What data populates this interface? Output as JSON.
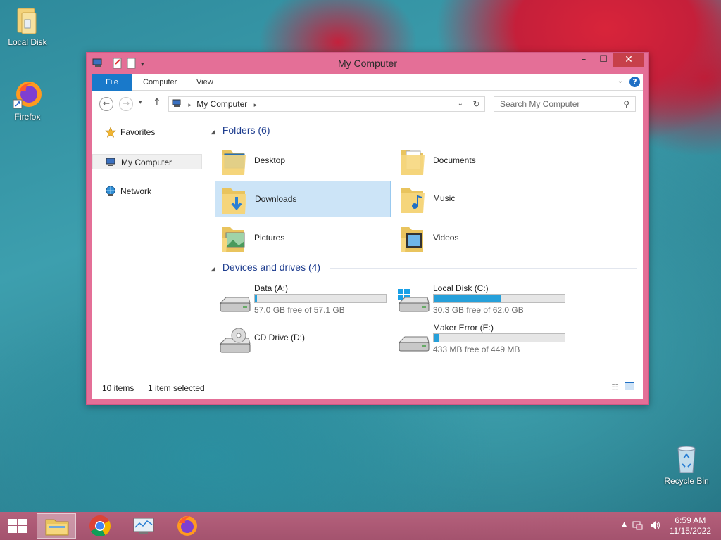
{
  "desktop": {
    "icons": [
      {
        "label": "Local Disk"
      },
      {
        "label": "Firefox"
      },
      {
        "label": "Recycle Bin"
      }
    ]
  },
  "window": {
    "title": "My Computer",
    "ribbon_tabs": [
      "File",
      "Computer",
      "View"
    ],
    "address": "My Computer",
    "search_placeholder": "Search My Computer",
    "nav": {
      "favorites": "Favorites",
      "my_computer": "My Computer",
      "network": "Network"
    },
    "folders": {
      "header": "Folders (6)",
      "items": [
        {
          "label": "Desktop"
        },
        {
          "label": "Documents"
        },
        {
          "label": "Downloads",
          "selected": true
        },
        {
          "label": "Music"
        },
        {
          "label": "Pictures"
        },
        {
          "label": "Videos"
        }
      ]
    },
    "drives": {
      "header": "Devices and drives (4)",
      "items": [
        {
          "name": "Data (A:)",
          "free": "57.0 GB free of 57.1 GB",
          "used_fraction": 0.002
        },
        {
          "name": "Local Disk (C:)",
          "free": "30.3 GB free of 62.0 GB",
          "used_fraction": 0.51
        },
        {
          "name": "CD Drive (D:)",
          "free": "",
          "used_fraction": null
        },
        {
          "name": "Maker Error (E:)",
          "free": "433 MB free of 449 MB",
          "used_fraction": 0.036
        }
      ]
    },
    "status": {
      "items": "10 items",
      "selected": "1 item selected"
    }
  },
  "taskbar": {
    "time": "6:59 AM",
    "date": "11/15/2022"
  },
  "colors": {
    "accent": "#1979ca",
    "window_frame": "#e46f97",
    "close_button": "#c7404a",
    "drive_bar": "#26a0da",
    "selection": "#cce4f7"
  }
}
